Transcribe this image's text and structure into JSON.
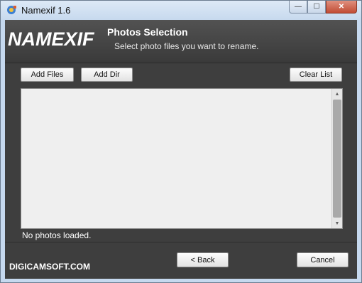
{
  "window": {
    "title": "Namexif 1.6",
    "controls": {
      "minimize": "—",
      "maximize": "☐",
      "close": "✕"
    }
  },
  "header": {
    "logo": "NAMEXIF",
    "title": "Photos Selection",
    "subtitle": "Select photo files you want to rename."
  },
  "toolbar": {
    "add_files": "Add Files",
    "add_dir": "Add Dir",
    "clear_list": "Clear List"
  },
  "file_list": {
    "items": []
  },
  "status": {
    "text": "No photos loaded."
  },
  "footer": {
    "brand": "DIGICAMSOFT.COM",
    "back": "< Back",
    "cancel": "Cancel"
  },
  "icons": {
    "app": "namexif-app-icon",
    "scroll_up": "scroll-up-arrow-icon",
    "scroll_down": "scroll-down-arrow-icon"
  }
}
